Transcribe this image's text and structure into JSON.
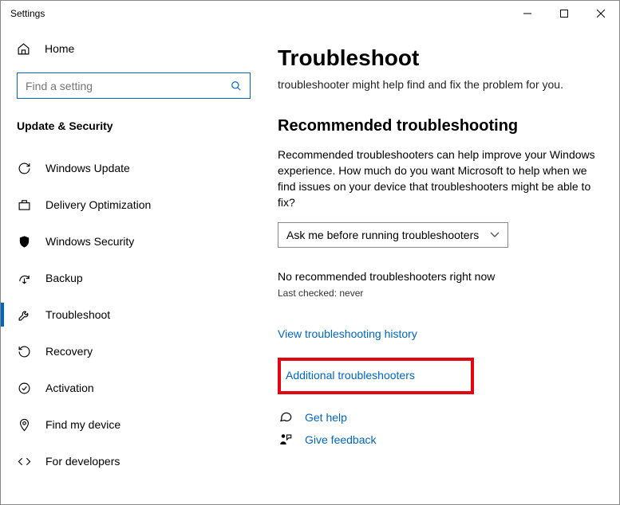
{
  "window": {
    "title": "Settings"
  },
  "sidebar": {
    "home": "Home",
    "search_placeholder": "Find a setting",
    "category": "Update & Security",
    "items": [
      {
        "label": "Windows Update"
      },
      {
        "label": "Delivery Optimization"
      },
      {
        "label": "Windows Security"
      },
      {
        "label": "Backup"
      },
      {
        "label": "Troubleshoot"
      },
      {
        "label": "Recovery"
      },
      {
        "label": "Activation"
      },
      {
        "label": "Find my device"
      },
      {
        "label": "For developers"
      }
    ]
  },
  "main": {
    "title": "Troubleshoot",
    "intro": "troubleshooter might help find and fix the problem for you.",
    "section_heading": "Recommended troubleshooting",
    "section_text": "Recommended troubleshooters can help improve your Windows experience. How much do you want Microsoft to help when we find issues on your device that troubleshooters might be able to fix?",
    "dropdown_value": "Ask me before running troubleshooters",
    "status": "No recommended troubleshooters right now",
    "last_checked": "Last checked: never",
    "history_link": "View troubleshooting history",
    "additional_link": "Additional troubleshooters",
    "get_help": "Get help",
    "give_feedback": "Give feedback"
  }
}
